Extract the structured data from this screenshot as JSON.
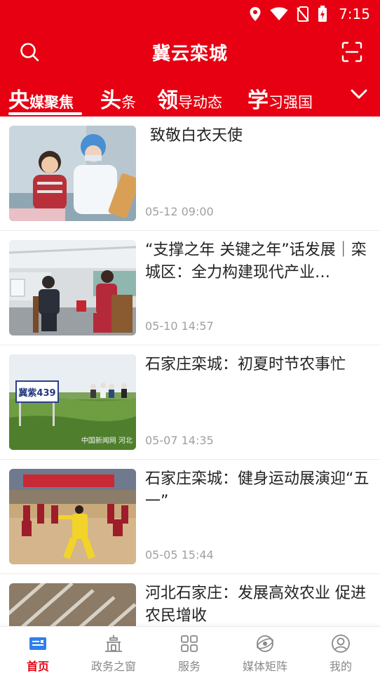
{
  "status": {
    "time": "7:15"
  },
  "header": {
    "title": "冀云栾城",
    "search_icon": "search-icon",
    "scan_icon": "scan-icon"
  },
  "tabs": [
    {
      "big": "央",
      "small": "媒聚焦",
      "active": true
    },
    {
      "big": "头",
      "small": "条"
    },
    {
      "big": "领",
      "small": "导动态"
    },
    {
      "big": "学",
      "small": "习强国"
    }
  ],
  "articles": [
    {
      "title": "致敬白衣天使",
      "time": "05-12 09:00"
    },
    {
      "title": "“支撑之年 关键之年”话发展｜栾城区：全力构建现代产业…",
      "time": "05-10 14:57"
    },
    {
      "title": "石家庄栾城：初夏时节农事忙",
      "time": "05-07 14:35",
      "sign_text": "冀紫439",
      "watermark": "中国新闻网 河北"
    },
    {
      "title": "石家庄栾城：健身运动展演迎“五一”",
      "time": "05-05 15:44"
    },
    {
      "title": "河北石家庄：发展高效农业 促进农民增收",
      "time": ""
    }
  ],
  "nav": [
    {
      "label": "首页",
      "icon": "home-icon",
      "active": true
    },
    {
      "label": "政务之窗",
      "icon": "government-icon"
    },
    {
      "label": "服务",
      "icon": "grid-icon"
    },
    {
      "label": "媒体矩阵",
      "icon": "globe-icon"
    },
    {
      "label": "我的",
      "icon": "profile-icon"
    }
  ],
  "colors": {
    "brand": "#e60012",
    "text": "#222222",
    "muted": "#a0a0a0"
  }
}
